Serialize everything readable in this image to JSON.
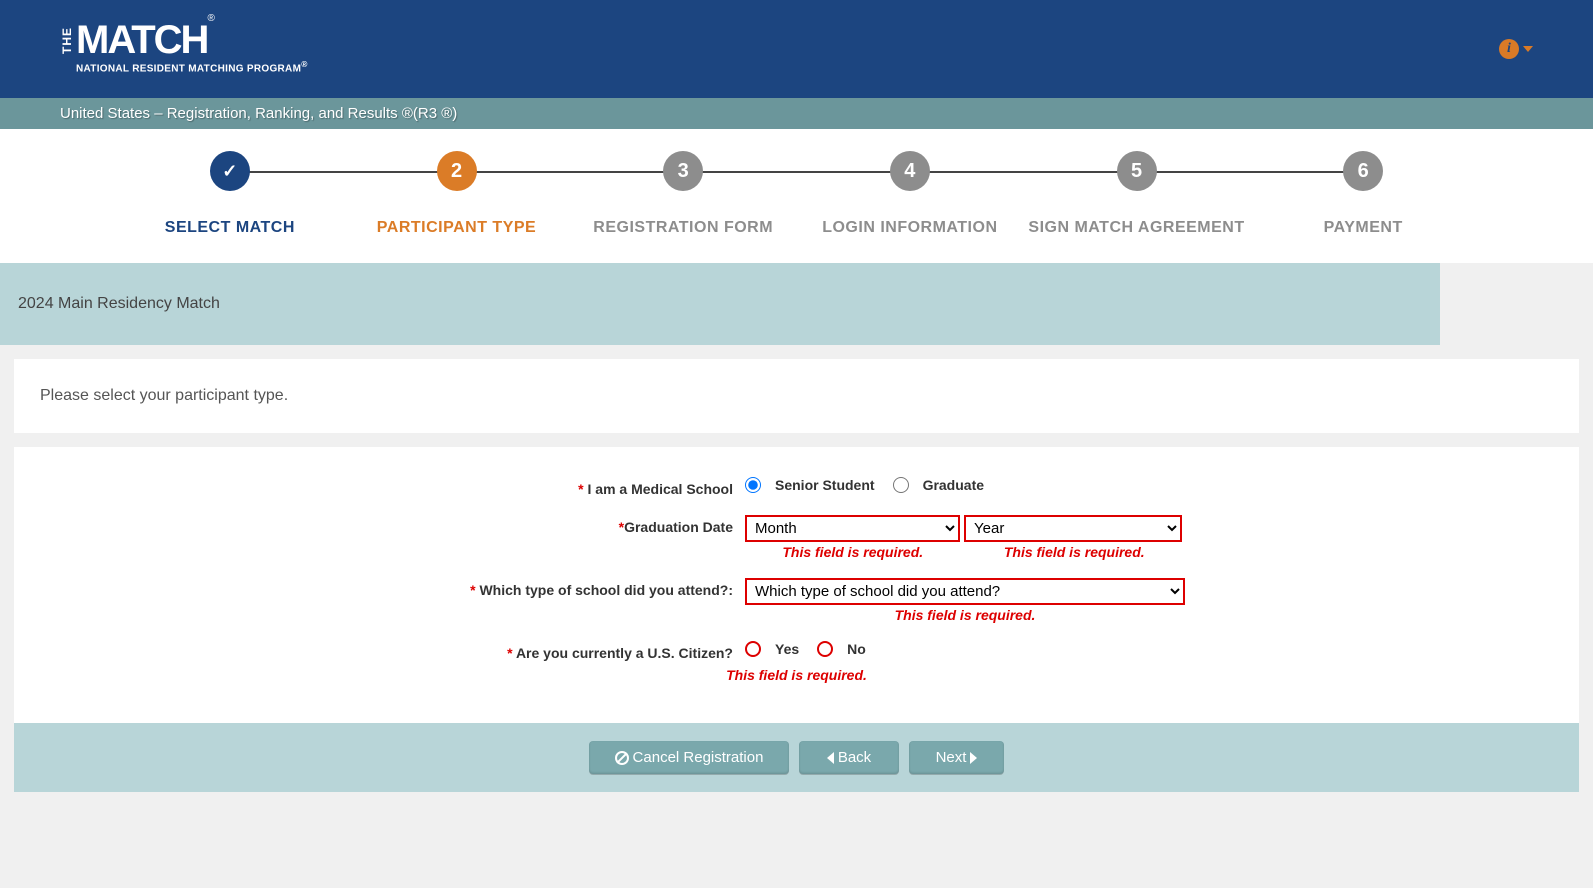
{
  "header": {
    "logo_the": "THE",
    "logo_main": "MATCH",
    "logo_sub": "NATIONAL RESIDENT MATCHING PROGRAM",
    "logo_reg": "®"
  },
  "subheader": "United States   –   Registration, Ranking, and Results ®(R3 ®)",
  "steps": [
    {
      "label": "SELECT MATCH",
      "state": "done",
      "num": ""
    },
    {
      "label": "PARTICIPANT TYPE",
      "state": "active",
      "num": "2"
    },
    {
      "label": "REGISTRATION FORM",
      "state": "inactive",
      "num": "3"
    },
    {
      "label": "LOGIN INFORMATION",
      "state": "inactive",
      "num": "4"
    },
    {
      "label": "SIGN MATCH AGREEMENT",
      "state": "inactive",
      "num": "5"
    },
    {
      "label": "PAYMENT",
      "state": "inactive",
      "num": "6"
    }
  ],
  "banner": "2024 Main Residency Match",
  "instruction": "Please select your participant type.",
  "form": {
    "medical_school_label": "I am a Medical School",
    "senior_student": "Senior Student",
    "graduate": "Graduate",
    "graduation_label": "Graduation Date",
    "month_placeholder": "Month",
    "year_placeholder": "Year",
    "school_type_label": "Which type of school did you attend?:",
    "school_type_placeholder": "Which type of school did you attend?",
    "citizen_label": "Are you currently a U.S. Citizen?",
    "yes": "Yes",
    "no": "No",
    "error_required": "This field is required."
  },
  "buttons": {
    "cancel": "Cancel Registration",
    "back": "Back",
    "next": "Next"
  }
}
